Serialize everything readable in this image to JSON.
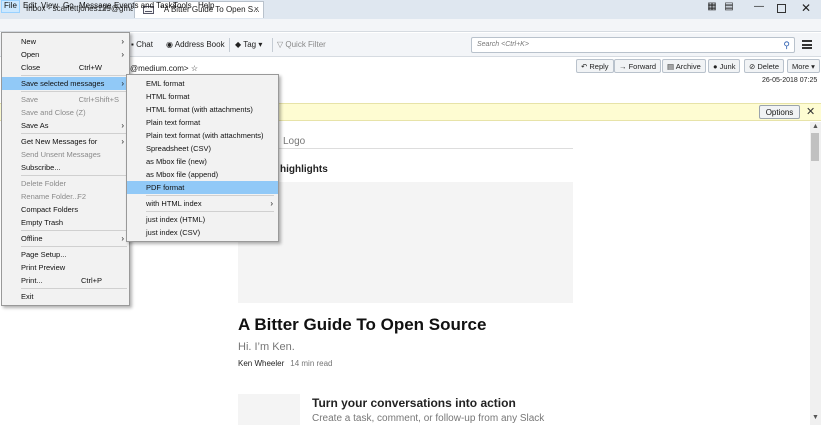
{
  "tabs": [
    {
      "label": "Inbox - scarlettjones129@gma..."
    },
    {
      "label": "\"A Bitter Guide To Open S...",
      "close": "×"
    }
  ],
  "window": {
    "minimize": "—",
    "maximize": "",
    "close": "✕",
    "calendar": "▦",
    "tasks": "▤"
  },
  "menubar": {
    "file": "File",
    "edit": "Edit",
    "view": "View",
    "go": "Go",
    "message": "Message",
    "events": "Events and Tasks",
    "tools": "Tools",
    "help": "Help"
  },
  "toolbar": {
    "chat": "Chat",
    "address_book": "Address Book",
    "tag": "Tag",
    "quick_filter": "Quick Filter",
    "search_placeholder": "Search <Ctrl+K>"
  },
  "header": {
    "reply": "Reply",
    "forward": "Forward",
    "archive": "Archive",
    "junk": "Junk",
    "delete": "Delete",
    "more": "More",
    "from_partial": "@medium.com>",
    "date": "26-05-2018 07:25"
  },
  "notification": {
    "options": "Options",
    "close": "✕"
  },
  "content": {
    "logo_text": "Logo",
    "highlights": "highlights",
    "title": "A Bitter Guide To Open Source",
    "greeting": "Hi. I’m Ken.",
    "author": "Ken Wheeler",
    "read_time": "14 min read",
    "promo_title": "Turn your conversations into action",
    "promo_sub": "Create a task, comment, or follow-up from any Slack"
  },
  "file_menu": {
    "new": "New",
    "open": "Open",
    "close": "Close",
    "close_sc": "Ctrl+W",
    "save_selected": "Save selected messages",
    "save": "Save",
    "save_sc": "Ctrl+Shift+S",
    "save_close": "Save and Close (Z)",
    "save_as": "Save As",
    "get_new": "Get New Messages for",
    "send_unsent": "Send Unsent Messages",
    "subscribe": "Subscribe...",
    "delete_folder": "Delete Folder",
    "rename_folder": "Rename Folder...",
    "rename_sc": "F2",
    "compact": "Compact Folders",
    "empty_trash": "Empty Trash",
    "offline": "Offline",
    "page_setup": "Page Setup...",
    "print_preview": "Print Preview",
    "print": "Print...",
    "print_sc": "Ctrl+P",
    "exit": "Exit"
  },
  "save_submenu": {
    "eml": "EML format",
    "html": "HTML format",
    "html_att": "HTML format (with attachments)",
    "plain": "Plain text format",
    "plain_att": "Plain text format (with attachments)",
    "csv": "Spreadsheet (CSV)",
    "mbox_new": "as Mbox file (new)",
    "mbox_append": "as Mbox file (append)",
    "pdf": "PDF format",
    "with_html_index": "with HTML index",
    "index_html": "just index (HTML)",
    "index_csv": "just index (CSV)"
  }
}
